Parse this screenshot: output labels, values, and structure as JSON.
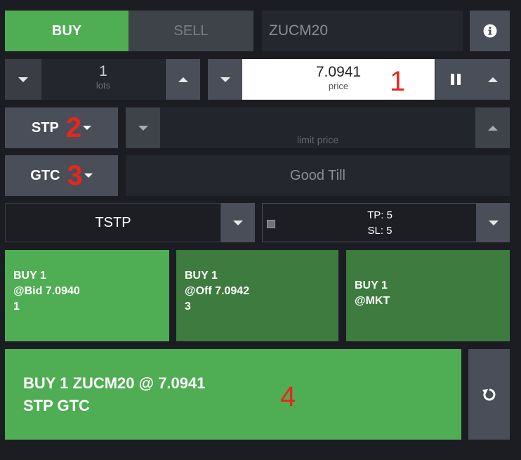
{
  "tabs": {
    "buy": "BUY",
    "sell": "SELL"
  },
  "symbol": {
    "value": "ZUCM20"
  },
  "info_icon": "info-icon",
  "quantity": {
    "value": "1",
    "unit": "lots"
  },
  "price": {
    "value": "7.0941",
    "label": "price"
  },
  "annotations": {
    "one": "1",
    "two": "2",
    "three": "3",
    "four": "4"
  },
  "order_type": {
    "selected": "STP"
  },
  "limit_price": {
    "placeholder": "limit price"
  },
  "duration": {
    "selected": "GTC"
  },
  "good_till": {
    "placeholder": "Good Till"
  },
  "strategy": {
    "selected": "TSTP",
    "tp": "TP: 5",
    "sl": "SL: 5"
  },
  "quick_orders": [
    {
      "line1": "BUY 1",
      "line2": "@Bid 7.0940",
      "line3": "1"
    },
    {
      "line1": "BUY 1",
      "line2": "@Off 7.0942",
      "line3": "3"
    },
    {
      "line1": "BUY 1",
      "line2": "@MKT",
      "line3": ""
    }
  ],
  "submit": {
    "line1": "BUY 1 ZUCM20 @ 7.0941",
    "line2": "STP GTC"
  },
  "colors": {
    "buy_green": "#4fad54",
    "dark_green": "#3d7b3f",
    "panel_bg": "#1b1d22",
    "button_gray": "#4a4e58",
    "annotation_red": "#e8261c"
  }
}
